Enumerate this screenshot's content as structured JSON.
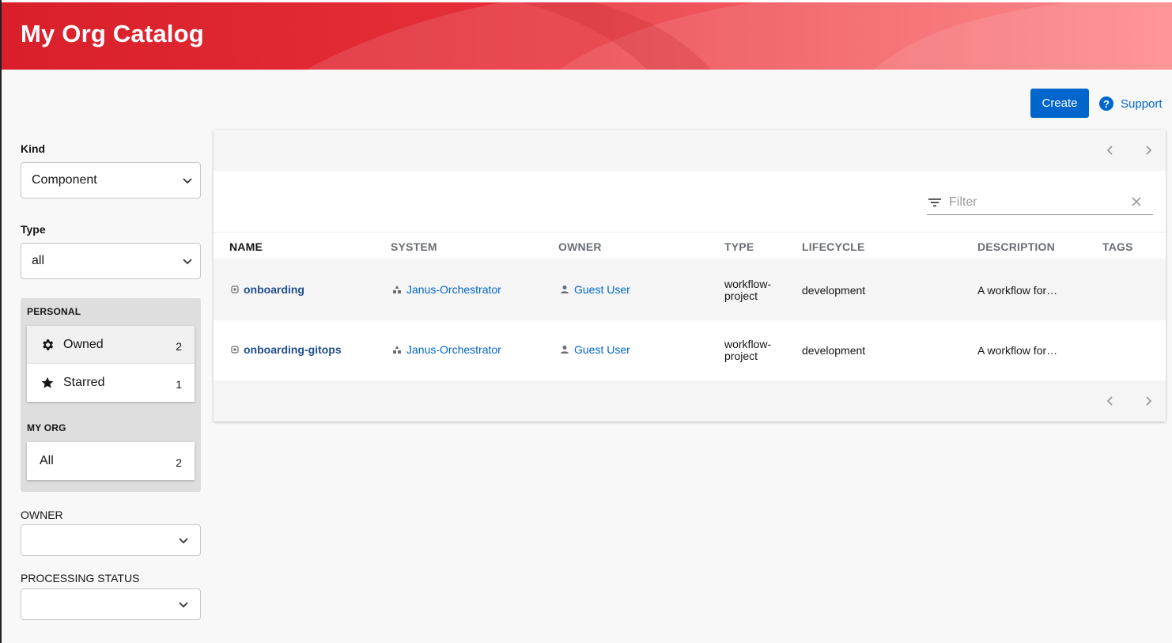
{
  "header": {
    "title": "My Org Catalog"
  },
  "actions": {
    "create_label": "Create",
    "support_label": "Support",
    "support_icon": "question-circle-icon"
  },
  "sidebar": {
    "kind_label": "Kind",
    "kind_value": "Component",
    "type_label": "Type",
    "type_value": "all",
    "personal_heading": "PERSONAL",
    "owned_label": "Owned",
    "owned_count": "2",
    "starred_label": "Starred",
    "starred_count": "1",
    "myorg_heading": "MY ORG",
    "all_label": "All",
    "all_count": "2",
    "owner_label": "OWNER",
    "owner_value": "",
    "processing_label": "PROCESSING STATUS",
    "processing_value": ""
  },
  "table": {
    "filter_placeholder": "Filter",
    "columns": [
      "NAME",
      "SYSTEM",
      "OWNER",
      "TYPE",
      "LIFECYCLE",
      "DESCRIPTION",
      "TAGS"
    ],
    "rows": [
      {
        "name": "onboarding",
        "system": "Janus-Orchestrator",
        "owner": "Guest User",
        "type_line1": "workflow-",
        "type_line2": "project",
        "lifecycle": "development",
        "description": "A workflow for…",
        "tags": ""
      },
      {
        "name": "onboarding-gitops",
        "system": "Janus-Orchestrator",
        "owner": "Guest User",
        "type_line1": "workflow-",
        "type_line2": "project",
        "lifecycle": "development",
        "description": "A workflow for…",
        "tags": ""
      }
    ]
  },
  "colors": {
    "header_red": "#e0252f",
    "primary_blue": "#0066cc",
    "link_blue": "#1f4e8c"
  }
}
